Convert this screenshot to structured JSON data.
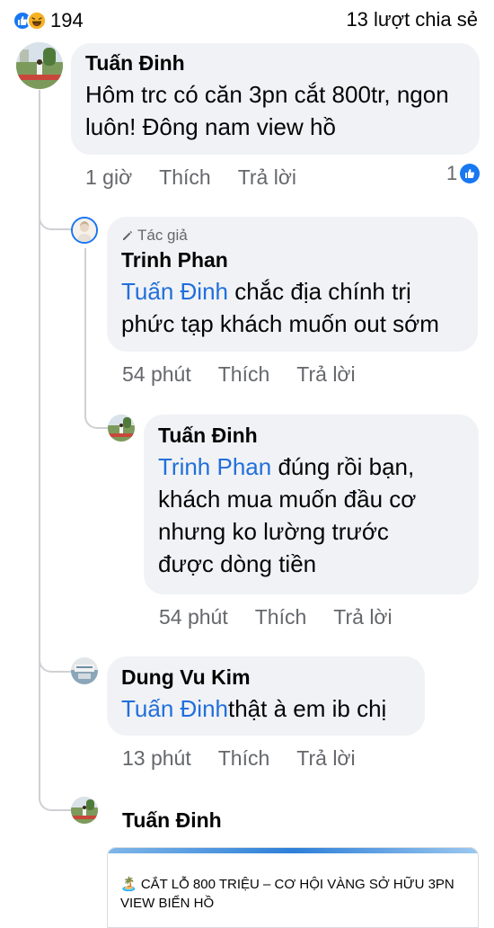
{
  "header": {
    "reaction_count": "194",
    "shares": "13 lượt chia sẻ",
    "reaction_icons": [
      "like-icon",
      "haha-icon"
    ]
  },
  "comments": [
    {
      "author": "Tuấn Đinh",
      "text": "Hôm trc có căn 3pn cắt 800tr, ngon luôn! Đông nam view hồ",
      "time": "1 giờ",
      "like": "Thích",
      "reply": "Trả lời",
      "like_count": "1"
    },
    {
      "badge": "Tác giả",
      "author": "Trinh Phan",
      "mention": "Tuấn Đinh",
      "text": " chắc địa chính trị phức tạp khách muốn out sớm",
      "time": "54 phút",
      "like": "Thích",
      "reply": "Trả lời"
    },
    {
      "author": "Tuấn Đinh",
      "mention": "Trinh Phan",
      "text": " đúng rồi bạn, khách mua muốn đầu cơ nhưng ko lường trước được dòng tiền",
      "time": "54 phút",
      "like": "Thích",
      "reply": "Trả lời"
    },
    {
      "author": "Dung Vu Kim",
      "mention": "Tuấn Đinh",
      "text": "thật à em ib chị",
      "time": "13 phút",
      "like": "Thích",
      "reply": "Trả lời"
    },
    {
      "author": "Tuấn Đinh",
      "link_card_text": "🏝️ CẮT LỖ 800 TRIỆU – CƠ HỘI VÀNG SỞ HỮU 3PN VIEW BIỂN HỒ"
    }
  ],
  "colors": {
    "accent": "#1877f2",
    "mention": "#216fdb",
    "bubble": "#f0f2f5",
    "meta": "#65676b",
    "thread_line": "#ced0d4"
  }
}
